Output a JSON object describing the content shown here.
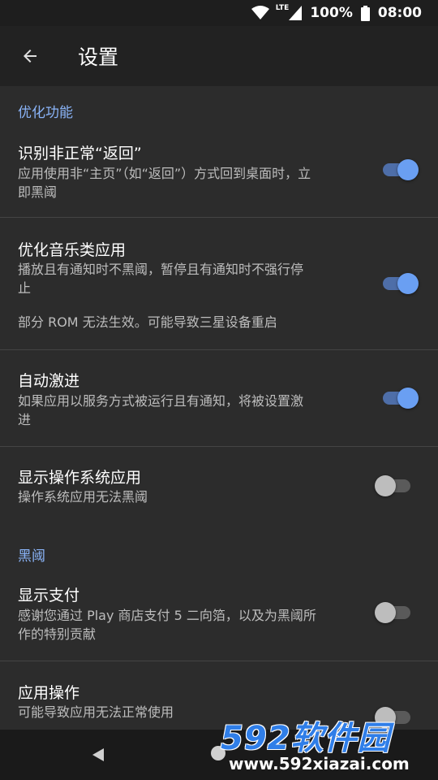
{
  "status_bar": {
    "network": "LTE",
    "battery": "100%",
    "time": "08:00"
  },
  "app_bar": {
    "title": "设置"
  },
  "sections": [
    {
      "header": "优化功能",
      "items": [
        {
          "title": "识别非正常“返回”",
          "summary_lines": [
            "应用使用非“主页”（如“返回”）方式回到桌面时，立",
            "即黑阈"
          ],
          "switch_on": true
        },
        {
          "title": "优化音乐类应用",
          "summary_lines": [
            "播放且有通知时不黑阈，暂停且有通知时不强行停",
            "止"
          ],
          "note": "部分 ROM 无法生效。可能导致三星设备重启",
          "switch_on": true
        },
        {
          "title": "自动激进",
          "summary_lines": [
            "如果应用以服务方式被运行且有通知，将被设置激",
            "进"
          ],
          "switch_on": true
        },
        {
          "title": "显示操作系统应用",
          "summary_lines": [
            "操作系统应用无法黑阈"
          ],
          "switch_on": false
        }
      ]
    },
    {
      "header": "黑阈",
      "items": [
        {
          "title": "显示支付",
          "summary_lines": [
            "感谢您通过 Play 商店支付 5 二向箔，以及为黑阈所",
            "作的特别贡献"
          ],
          "switch_on": false
        },
        {
          "title": "应用操作",
          "summary_lines": [
            "可能导致应用无法正常使用"
          ],
          "switch_on": false
        }
      ]
    }
  ],
  "watermark": {
    "logo": "592软件园",
    "url": "www.592xiazai.com"
  },
  "colors": {
    "accent": "#8ab4f8",
    "switch_on_thumb": "#6a9ff2",
    "switch_on_track": "#4e6ea8",
    "background": "#2c2c2c"
  },
  "icons": [
    "wifi-icon",
    "battery-icon",
    "back-arrow-icon",
    "nav-back-icon",
    "nav-home-icon"
  ]
}
